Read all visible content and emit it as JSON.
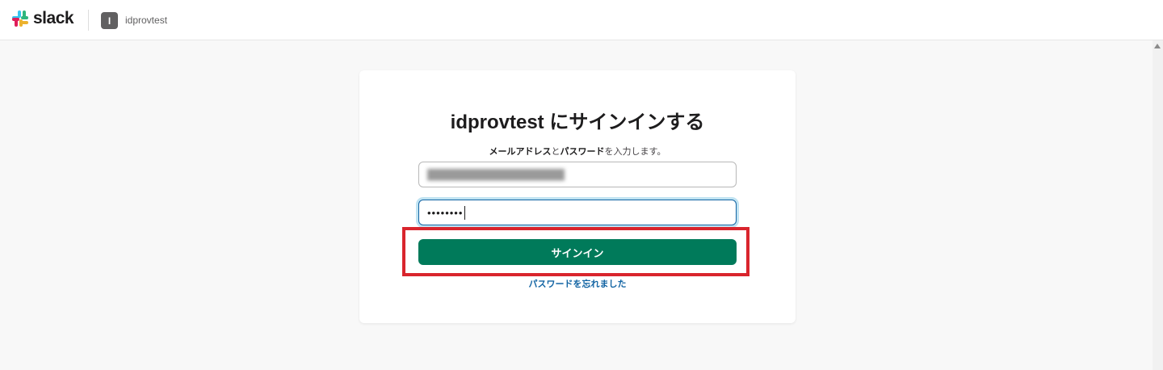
{
  "header": {
    "logo_text": "slack",
    "workspace_initial": "I",
    "workspace_name": "idprovtest"
  },
  "signin": {
    "title": "idprovtest にサインインする",
    "subtitle_part1": "メールアドレス",
    "subtitle_part2": "と",
    "subtitle_part3": "パスワード",
    "subtitle_part4": "を入力します。",
    "email_value": "",
    "password_value": "••••••••",
    "button_label": "サインイン",
    "forgot_link": "パスワードを忘れました"
  },
  "colors": {
    "primary_button": "#007a5a",
    "link": "#1264a3",
    "highlight": "#d9252d"
  },
  "icons": {
    "logo": "slack-logo-icon",
    "scroll": "scroll-up-arrow-icon"
  }
}
